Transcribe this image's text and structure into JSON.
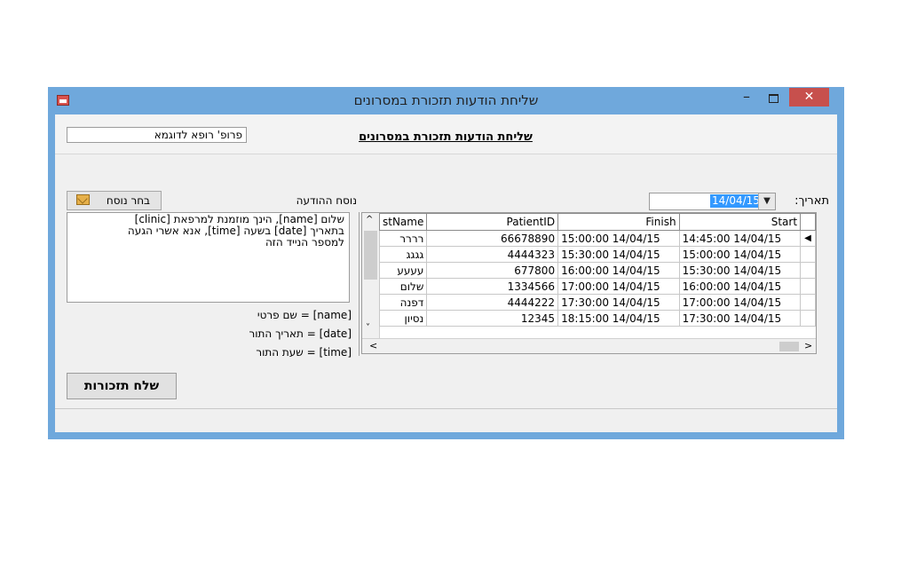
{
  "window": {
    "title": "שליחת הודעות תזכורת במסרונים",
    "minimize_glyph": "–",
    "close_glyph": "✕"
  },
  "header": {
    "doctor_name": "פרופ' רופא לדוגמא",
    "form_title": "שליחת הודעות תזכורת במסרונים"
  },
  "template": {
    "label": "נוסח ההודעה",
    "choose_button": "בחר נוסח",
    "message_lines": [
      "שלום [name], הינך מוזמנת למרפאת [clinic]",
      "בתאריך [date] בשעה [time], אנא אשרי הגעה",
      "למספר הנייד הזה"
    ],
    "legend": [
      "[name] = שם פרטי",
      "[date] = תאריך התור",
      "[time] = שעת התור"
    ]
  },
  "date_filter": {
    "label": "תאריך:",
    "value": "14/04/15"
  },
  "grid": {
    "columns": [
      "stName",
      "PatientID",
      "Finish",
      "Start"
    ],
    "rows": [
      {
        "name": "רררר",
        "pid": "66678890",
        "finish": "15:00:00 14/04/15",
        "start": "14:45:00 14/04/15"
      },
      {
        "name": "גגגג",
        "pid": "4444323",
        "finish": "15:30:00 14/04/15",
        "start": "15:00:00 14/04/15"
      },
      {
        "name": "עעעע",
        "pid": "677800",
        "finish": "16:00:00 14/04/15",
        "start": "15:30:00 14/04/15"
      },
      {
        "name": "שלום",
        "pid": "1334566",
        "finish": "17:00:00 14/04/15",
        "start": "16:00:00 14/04/15"
      },
      {
        "name": "דפנה",
        "pid": "4444222",
        "finish": "17:30:00 14/04/15",
        "start": "17:00:00 14/04/15"
      },
      {
        "name": "נסיון",
        "pid": "12345",
        "finish": "18:15:00 14/04/15",
        "start": "17:30:00 14/04/15"
      }
    ]
  },
  "actions": {
    "send_button": "שלח תזכורות"
  }
}
